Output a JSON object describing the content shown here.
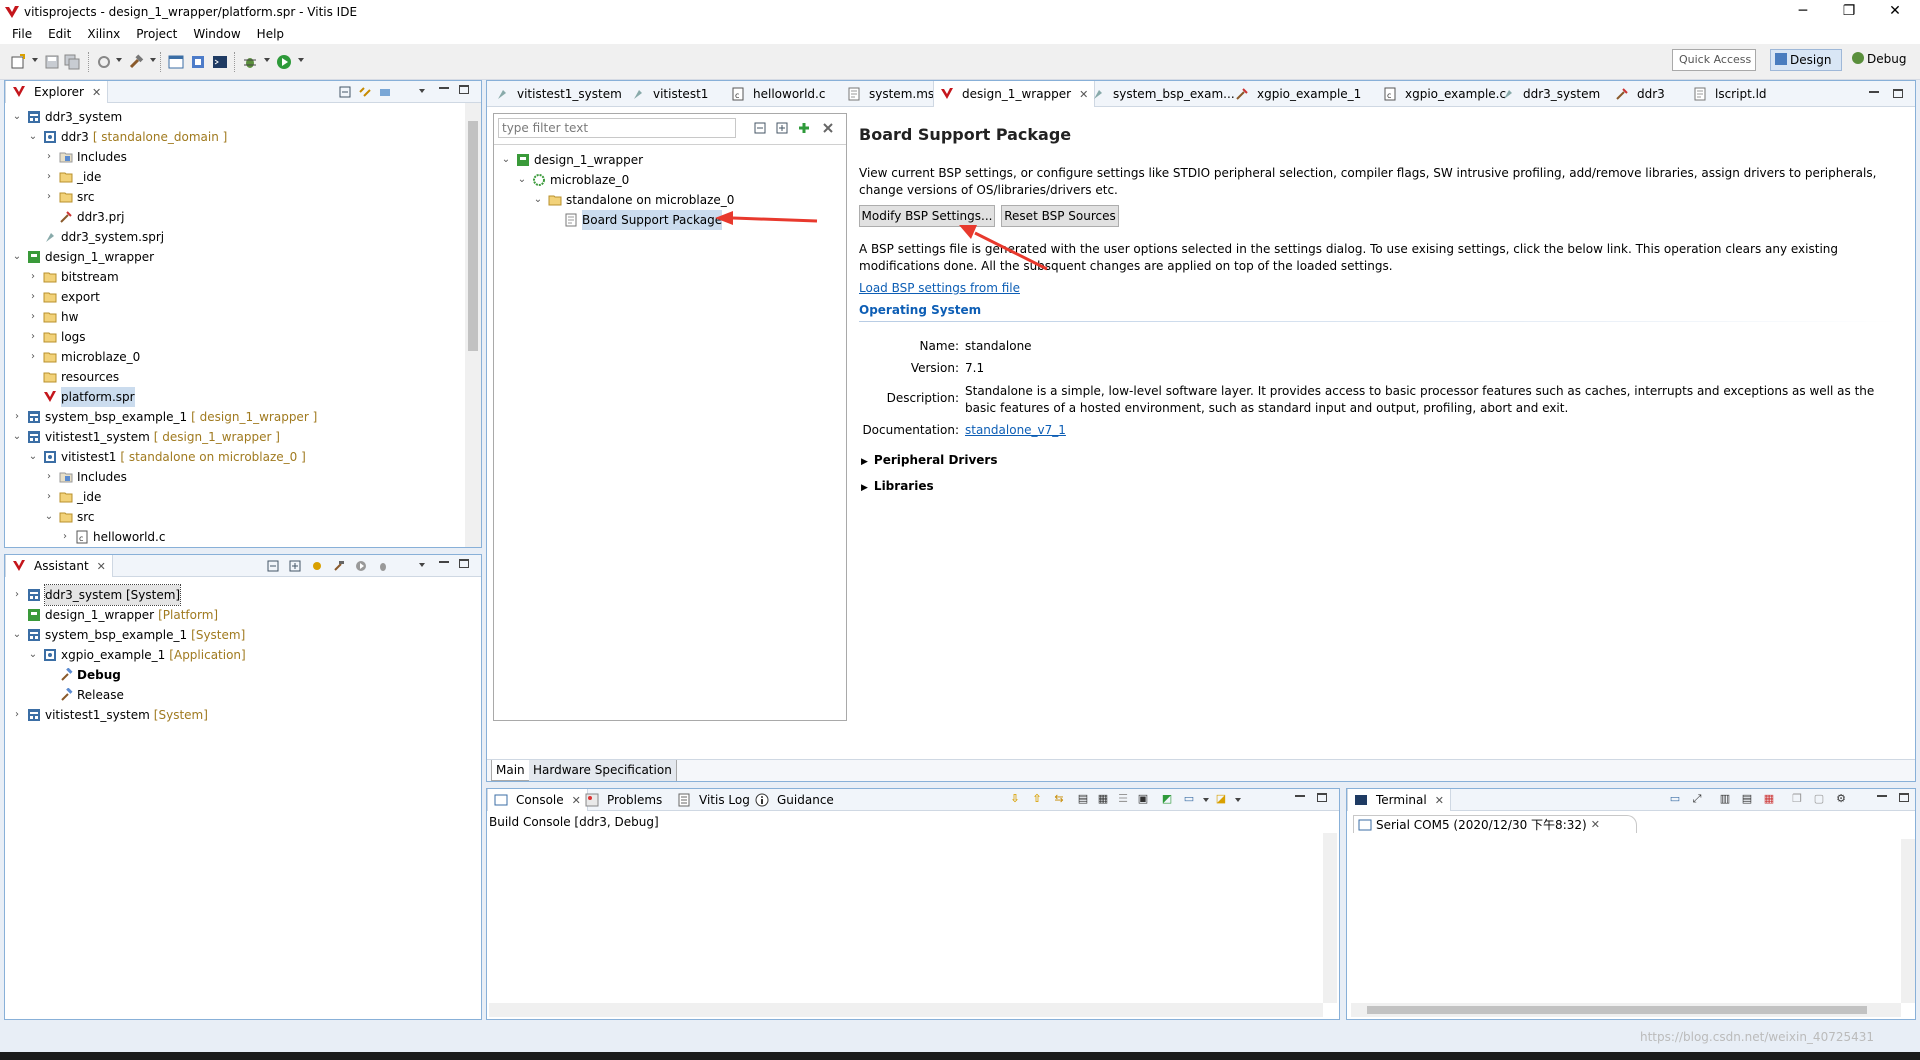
{
  "window": {
    "title": "vitisprojects - design_1_wrapper/platform.spr - Vitis IDE",
    "min": "─",
    "max": "❐",
    "close": "✕"
  },
  "menu": [
    "File",
    "Edit",
    "Xilinx",
    "Project",
    "Window",
    "Help"
  ],
  "toolbar": {
    "quick_access": "Quick Access",
    "perspective_design": "Design",
    "perspective_debug": "Debug"
  },
  "explorer": {
    "tab": "Explorer",
    "items": [
      {
        "label": "ddr3_system",
        "annot": ""
      },
      {
        "label": "ddr3",
        "annot": "[ standalone_domain ]"
      },
      {
        "label": "Includes",
        "annot": ""
      },
      {
        "label": "_ide",
        "annot": ""
      },
      {
        "label": "src",
        "annot": ""
      },
      {
        "label": "ddr3.prj",
        "annot": ""
      },
      {
        "label": "ddr3_system.sprj",
        "annot": ""
      },
      {
        "label": "design_1_wrapper",
        "annot": ""
      },
      {
        "label": "bitstream",
        "annot": ""
      },
      {
        "label": "export",
        "annot": ""
      },
      {
        "label": "hw",
        "annot": ""
      },
      {
        "label": "logs",
        "annot": ""
      },
      {
        "label": "microblaze_0",
        "annot": ""
      },
      {
        "label": "resources",
        "annot": ""
      },
      {
        "label": "platform.spr",
        "annot": ""
      },
      {
        "label": "system_bsp_example_1",
        "annot": "[ design_1_wrapper ]"
      },
      {
        "label": "vitistest1_system",
        "annot": "[ design_1_wrapper ]"
      },
      {
        "label": "vitistest1",
        "annot": "[ standalone on microblaze_0 ]"
      },
      {
        "label": "Includes",
        "annot": ""
      },
      {
        "label": "_ide",
        "annot": ""
      },
      {
        "label": "src",
        "annot": ""
      },
      {
        "label": "helloworld.c",
        "annot": ""
      }
    ]
  },
  "assistant": {
    "tab": "Assistant",
    "items": [
      {
        "label": "ddr3_system [System]",
        "annot": ""
      },
      {
        "label": "design_1_wrapper",
        "annot": "[Platform]"
      },
      {
        "label": "system_bsp_example_1",
        "annot": "[System]"
      },
      {
        "label": "xgpio_example_1",
        "annot": "[Application]"
      },
      {
        "label": "Debug",
        "annot": ""
      },
      {
        "label": "Release",
        "annot": ""
      },
      {
        "label": "vitistest1_system",
        "annot": "[System]"
      }
    ]
  },
  "editor_tabs": [
    "vitistest1_system",
    "vitistest1",
    "helloworld.c",
    "system.mss",
    "design_1_wrapper",
    "system_bsp_exam...",
    "xgpio_example_1",
    "xgpio_example.c",
    "ddr3_system",
    "ddr3",
    "lscript.ld"
  ],
  "platform_tree": {
    "filter_placeholder": "type filter text",
    "items": [
      "design_1_wrapper",
      "microblaze_0",
      "standalone on microblaze_0",
      "Board Support Package"
    ]
  },
  "bsp": {
    "heading": "Board Support Package",
    "desc": "View current BSP settings, or configure settings like STDIO peripheral selection, compiler flags, SW intrusive profiling, add/remove libraries, assign drivers to peripherals, change versions of OS/libraries/drivers etc.",
    "modify_btn": "Modify BSP Settings...",
    "reset_btn": "Reset BSP Sources",
    "note": "A BSP settings file is generated with the user options selected in the settings dialog. To use exising settings, click the below link. This operation clears any existing modifications done. All the subsquent changes are applied on top of the loaded settings.",
    "load_link": "Load BSP settings from file",
    "os_section": "Operating System",
    "name_label": "Name:",
    "name_val": "standalone",
    "version_label": "Version:",
    "version_val": "7.1",
    "description_label": "Description:",
    "description_val": "Standalone is a simple, low-level software layer. It provides access to basic processor features such as caches, interrupts and exceptions as well as the basic features of a hosted environment, such as standard input and output, profiling, abort and exit.",
    "doc_label": "Documentation:",
    "doc_val": "standalone_v7_1",
    "peripheral_drivers": "Peripheral Drivers",
    "libraries": "Libraries"
  },
  "editor_bottom_tabs": [
    "Main",
    "Hardware Specification"
  ],
  "console": {
    "tabs": [
      "Console",
      "Problems",
      "Vitis Log",
      "Guidance"
    ],
    "title": "Build Console [ddr3, Debug]"
  },
  "terminal": {
    "tab": "Terminal",
    "session": "Serial COM5 (2020/12/30 下午8:32)"
  },
  "watermark": "https://blog.csdn.net/weixin_40725431",
  "colors": {
    "accent": "#0d5eb5",
    "annot": "#a07a1f",
    "arrow": "#e8392d"
  }
}
